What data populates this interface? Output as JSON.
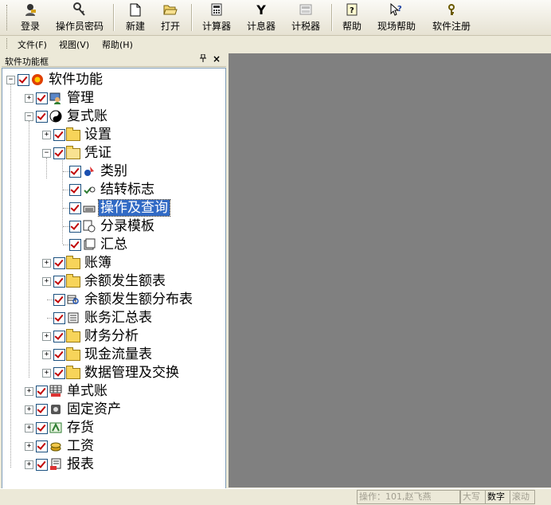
{
  "toolbar": {
    "buttons": [
      {
        "label": "登录",
        "icon": "login-icon"
      },
      {
        "label": "操作员密码",
        "icon": "key-icon"
      },
      {
        "label": "新建",
        "icon": "new-file-icon"
      },
      {
        "label": "打开",
        "icon": "open-folder-icon"
      },
      {
        "label": "计算器",
        "icon": "calculator-icon"
      },
      {
        "label": "计息器",
        "icon": "yen-icon"
      },
      {
        "label": "计税器",
        "icon": "tax-calculator-icon"
      },
      {
        "label": "帮助",
        "icon": "help-icon"
      },
      {
        "label": "现场帮助",
        "icon": "context-help-icon"
      },
      {
        "label": "软件注册",
        "icon": "register-icon"
      }
    ]
  },
  "menu": {
    "file": "文件(F)",
    "view": "视图(V)",
    "help": "帮助(H)"
  },
  "panel": {
    "title": "软件功能框",
    "pin": "ᵖ",
    "close": "×"
  },
  "tree": {
    "root": "软件功能",
    "manage": "管理",
    "double_entry": "复式账",
    "settings": "设置",
    "voucher": "凭证",
    "category": "类别",
    "transfer_flag": "结转标志",
    "operate_query": "操作及查询",
    "entry_template": "分录模板",
    "summary": "汇总",
    "ledger": "账簿",
    "balance_table": "余额发生额表",
    "balance_dist": "余额发生额分布表",
    "account_summary": "账务汇总表",
    "financial_analysis": "财务分析",
    "cash_flow": "现金流量表",
    "data_exchange": "数据管理及交换",
    "single_entry": "单式账",
    "fixed_assets": "固定资产",
    "inventory": "存货",
    "salary": "工资",
    "reports": "报表"
  },
  "status": {
    "operator": "操作：101,赵飞燕",
    "caps": "大写",
    "num": "数字",
    "scroll": "滚动"
  },
  "colors": {
    "selection": "#316ac5",
    "workspace": "#808080",
    "check": "#c00000"
  }
}
